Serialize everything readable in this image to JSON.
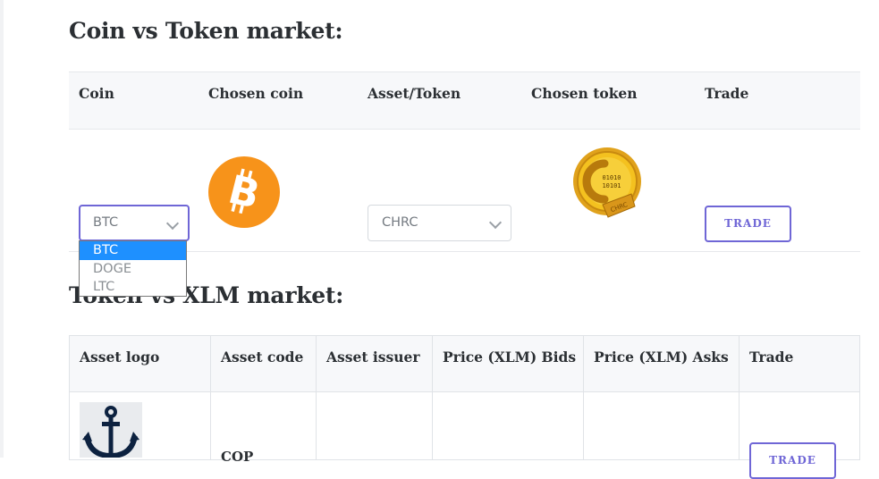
{
  "coin_market": {
    "title": "Coin vs Token market:",
    "headers": [
      "Coin",
      "Chosen coin",
      "Asset/Token",
      "Chosen token",
      "Trade"
    ],
    "coin_select": {
      "value": "BTC",
      "options": [
        "BTC",
        "DOGE",
        "LTC"
      ],
      "selected_index": 0
    },
    "token_select": {
      "value": "CHRC"
    },
    "coin_logo": "bitcoin-logo",
    "token_logo": "chrc-coin-logo",
    "token_logo_text": {
      "bits_top": "01010",
      "bits_bottom": "10101",
      "ribbon": "CHRC"
    },
    "trade_label": "TRADE"
  },
  "xlm_market": {
    "title": "Token vs XLM market:",
    "headers": [
      "Asset logo",
      "Asset code",
      "Asset issuer",
      "Price (XLM) Bids",
      "Price (XLM) Asks",
      "Trade"
    ],
    "row": {
      "asset_code": "COP",
      "logo": "anchor-icon",
      "trade_label": "TRADE"
    }
  },
  "colors": {
    "accent": "#6f66d6",
    "bitcoin": "#f7931a",
    "dropdown_highlight": "#1e90ff",
    "anchor": "#0d2240"
  }
}
